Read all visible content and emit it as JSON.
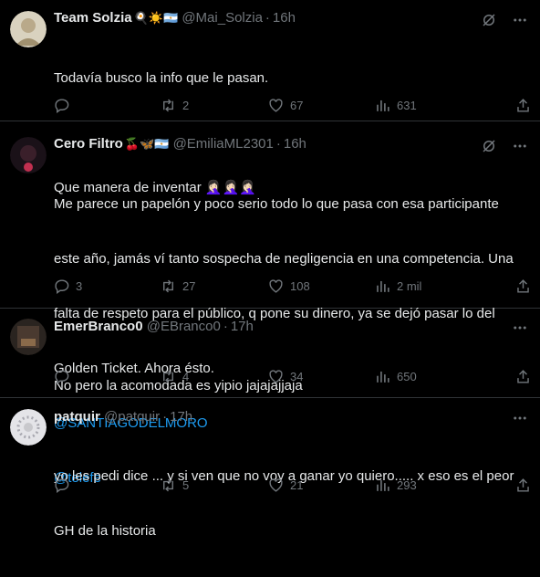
{
  "tweets": [
    {
      "name": "Team Solzia",
      "emoji": "🍳☀️🇦🇷",
      "handle": "@Mai_Solzia",
      "time": "16h",
      "lines": [
        "Todavía busco la info que le pasan.",
        "",
        "Que manera de inventar 🤦🏻‍♀️🤦🏻‍♀️🤦🏻‍♀️"
      ],
      "links": [],
      "replies": "",
      "retweets": "2",
      "likes": "67",
      "views": "631",
      "avatar_color": "#b9a98a"
    },
    {
      "name": "Cero Filtro",
      "emoji": "🍒🦋🇦🇷",
      "handle": "@EmiliaML2301",
      "time": "16h",
      "lines": [
        "Me parece un papelón y poco serio todo lo que pasa con esa participante",
        "este año, jamás ví tanto sospecha de negligencia en una competencia. Una",
        "falta de respeto para el público, q pone su dinero, ya se dejó pasar lo del",
        "Golden Ticket. Ahora ésto."
      ],
      "links": [
        "@SANTIAGODELMORO",
        "@telefe"
      ],
      "replies": "3",
      "retweets": "27",
      "likes": "108",
      "views": "2 mil",
      "avatar_color": "#3a1f2a"
    },
    {
      "name": "EmerBranco0",
      "emoji": "",
      "handle": "@EBranco0",
      "time": "17h",
      "lines": [
        "No pero la acomodada es yipio jajajajjaja"
      ],
      "links": [],
      "replies": "",
      "retweets": "4",
      "likes": "34",
      "views": "650",
      "avatar_color": "#4a3a30"
    },
    {
      "name": "patquir",
      "emoji": "",
      "handle": "@patquir",
      "time": "17h",
      "lines": [
        "yo les pedi dice ... y si ven que no voy a ganar yo quiero..... x eso es el peor",
        "GH de la historia"
      ],
      "links": [],
      "replies": "",
      "retweets": "5",
      "likes": "21",
      "views": "293",
      "avatar_color": "#c8c8cc"
    }
  ],
  "colors": {
    "background": "#000000",
    "text": "#e7e9ea",
    "muted": "#71767b",
    "link": "#1d9bf0",
    "divider": "#2f3336"
  },
  "icons": [
    "reply-icon",
    "retweet-icon",
    "like-icon",
    "views-icon",
    "share-icon",
    "grok-icon",
    "more-icon"
  ]
}
